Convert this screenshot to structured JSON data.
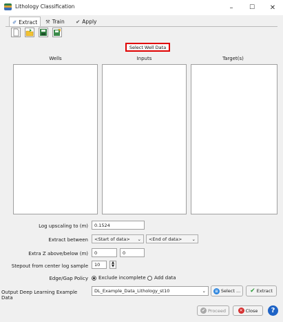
{
  "window": {
    "title": "Lithology Classification",
    "minimize": "–",
    "maximize": "☐",
    "close": "✕"
  },
  "tabs": [
    {
      "label": "Extract",
      "icon": "✐"
    },
    {
      "label": "Train",
      "icon": "⚒"
    },
    {
      "label": "Apply",
      "icon": "✔"
    }
  ],
  "toolbar": {
    "new": "new-file-icon",
    "open": "open-folder-icon",
    "save": "save-icon",
    "saveas": "save-as-icon"
  },
  "select_well_button": "Select Well Data",
  "columns": {
    "wells": "Wells",
    "inputs": "Inputs",
    "targets": "Target(s)"
  },
  "form": {
    "log_upscaling_label": "Log upscaling to (m)",
    "log_upscaling_value": "0.1524",
    "extract_between_label": "Extract between",
    "extract_start": "<Start of data>",
    "extract_end": "<End of data>",
    "extra_z_label": "Extra Z above/below (m)",
    "extra_z_above": "0",
    "extra_z_below": "0",
    "stepout_label": "Stepout from center log sample",
    "stepout_value": "10",
    "edge_gap_label": "Edge/Gap Policy",
    "policy_exclude": "Exclude incomplete",
    "policy_add": "Add data",
    "output_label": "Output Deep Learning Example Data",
    "output_value": "DL_Example_Data_Lithology_st10"
  },
  "buttons": {
    "select": "Select ...",
    "extract": "Extract",
    "proceed": "Proceed",
    "close": "Close",
    "help": "?"
  },
  "colors": {
    "highlight": "#e00000",
    "help_blue": "#1e63c6",
    "close_red": "#d62f2f",
    "select_blue": "#2e86de",
    "extract_green": "#2d9d3a"
  }
}
